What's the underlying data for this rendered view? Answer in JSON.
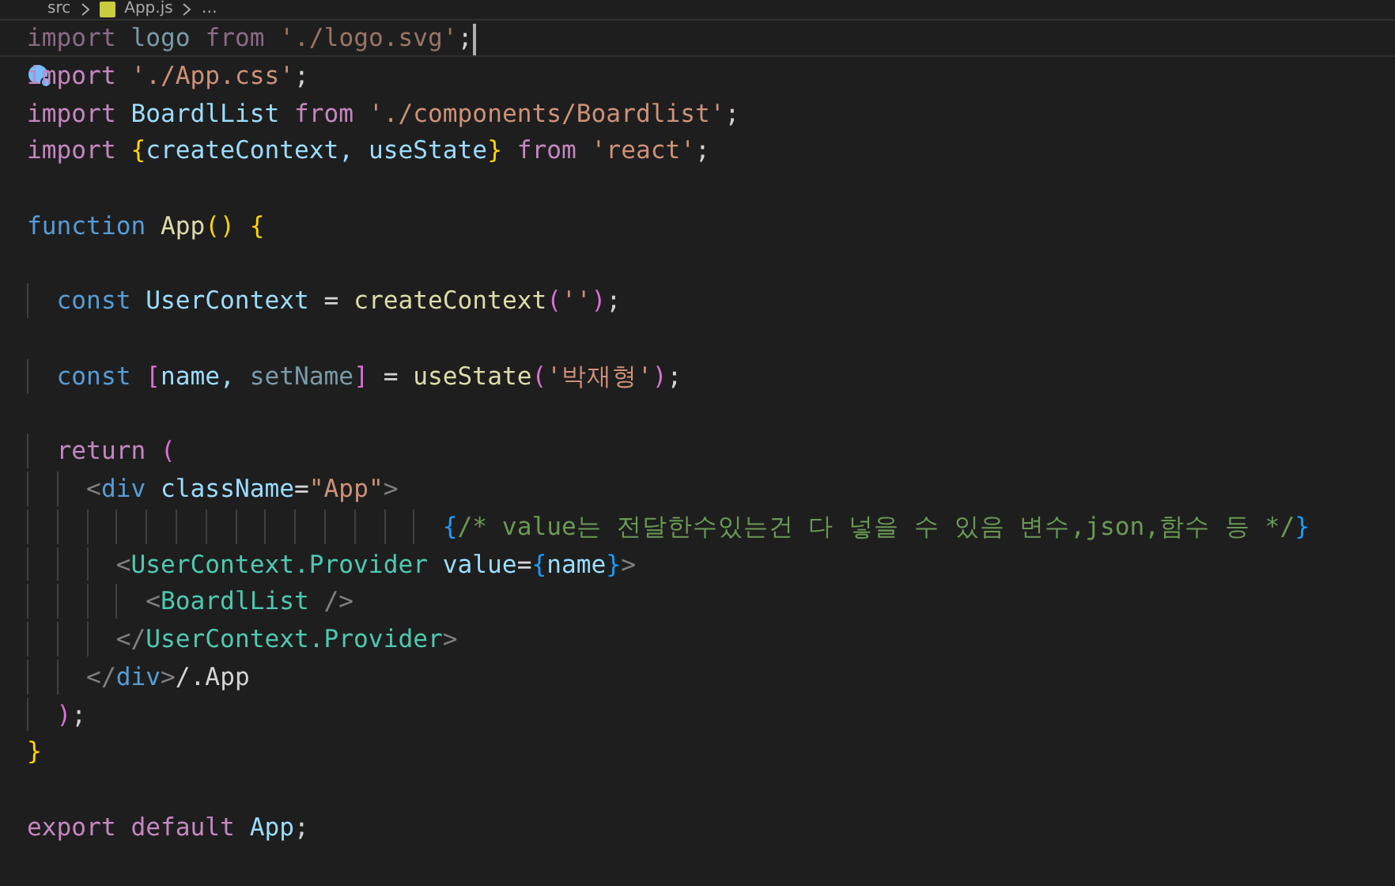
{
  "breadcrumb": [
    {
      "kind": "folder",
      "text": "src"
    },
    {
      "kind": "js_file",
      "text": "App.js"
    },
    {
      "kind": "more",
      "text": "…"
    }
  ],
  "blocks": [
    {
      "lines": [
        {
          "selected": true,
          "tokens": [
            {
              "kind": "dim_keyword",
              "text": "import"
            },
            {
              "kind": "dim_var",
              "text": " logo "
            },
            {
              "kind": "dim_keyword",
              "text": "from"
            },
            {
              "kind": "dim_string",
              "text": " './logo.svg'"
            },
            {
              "kind": "plain",
              "text": ";"
            }
          ]
        },
        {
          "selected": false,
          "tokens": [
            {
              "kind": "keyword",
              "text": "import"
            },
            {
              "kind": "string",
              "text": " './App.css'"
            },
            {
              "kind": "plain",
              "text": ";"
            }
          ]
        },
        {
          "selected": false,
          "tokens": [
            {
              "kind": "keyword",
              "text": "import"
            },
            {
              "kind": "var",
              "text": " BoardlList "
            },
            {
              "kind": "keyword",
              "text": "from"
            },
            {
              "kind": "string",
              "text": " './components/Boardlist'"
            },
            {
              "kind": "plain",
              "text": ";"
            }
          ]
        },
        {
          "selected": false,
          "tokens": [
            {
              "kind": "keyword",
              "text": "import"
            },
            {
              "kind": "bracket_gold",
              "text": " {"
            },
            {
              "kind": "var",
              "text": "createContext, useState"
            },
            {
              "kind": "bracket_gold",
              "text": "}"
            },
            {
              "kind": "keyword",
              "text": " from"
            },
            {
              "kind": "string",
              "text": " 'react'"
            },
            {
              "kind": "plain",
              "text": ";"
            }
          ]
        }
      ]
    },
    {
      "lines": [
        {
          "selected": false,
          "tokens": [
            {
              "kind": "storage",
              "text": "function"
            },
            {
              "kind": "func",
              "text": " App"
            },
            {
              "kind": "bracket_gold",
              "text": "() {"
            }
          ]
        }
      ]
    },
    {
      "lines": [
        {
          "selected": false,
          "tokens": [
            {
              "kind": "storage",
              "text": "  const"
            },
            {
              "kind": "var",
              "text": " UserContext "
            },
            {
              "kind": "plain",
              "text": "= "
            },
            {
              "kind": "func",
              "text": "createContext"
            },
            {
              "kind": "bracket_pink",
              "text": "("
            },
            {
              "kind": "string",
              "text": "''"
            },
            {
              "kind": "bracket_pink",
              "text": ")"
            },
            {
              "kind": "plain",
              "text": ";"
            }
          ]
        }
      ]
    },
    {
      "lines": [
        {
          "selected": false,
          "tokens": [
            {
              "kind": "storage",
              "text": "  const"
            },
            {
              "kind": "bracket_pink",
              "text": " ["
            },
            {
              "kind": "var",
              "text": "name, "
            },
            {
              "kind": "dim_var",
              "text": "setName"
            },
            {
              "kind": "bracket_pink",
              "text": "]"
            },
            {
              "kind": "plain",
              "text": " = "
            },
            {
              "kind": "func",
              "text": "useState"
            },
            {
              "kind": "bracket_pink",
              "text": "("
            },
            {
              "kind": "string",
              "text": "'박재형'"
            },
            {
              "kind": "bracket_pink",
              "text": ")"
            },
            {
              "kind": "plain",
              "text": ";"
            }
          ]
        }
      ]
    },
    {
      "lines": [
        {
          "selected": false,
          "tokens": [
            {
              "kind": "keyword",
              "text": "  return"
            },
            {
              "kind": "bracket_pink",
              "text": " ("
            }
          ]
        },
        {
          "selected": false,
          "tokens": [
            {
              "kind": "tag_punct",
              "text": "    <"
            },
            {
              "kind": "tag",
              "text": "div"
            },
            {
              "kind": "attr",
              "text": " className"
            },
            {
              "kind": "plain",
              "text": "="
            },
            {
              "kind": "string",
              "text": "\"App\""
            },
            {
              "kind": "tag_punct",
              "text": ">"
            }
          ]
        },
        {
          "selected": false,
          "tokens": [
            {
              "kind": "bracket_blue",
              "text": "                            {"
            },
            {
              "kind": "comment",
              "text": "/* value는 전달한수있는건 다 넣을 수 있음 변수,json,함수 등 */"
            },
            {
              "kind": "bracket_blue",
              "text": "}"
            }
          ]
        },
        {
          "selected": false,
          "tokens": [
            {
              "kind": "tag_punct",
              "text": "      <"
            },
            {
              "kind": "component",
              "text": "UserContext.Provider"
            },
            {
              "kind": "attr",
              "text": " value"
            },
            {
              "kind": "plain",
              "text": "="
            },
            {
              "kind": "bracket_blue",
              "text": "{"
            },
            {
              "kind": "var",
              "text": "name"
            },
            {
              "kind": "bracket_blue",
              "text": "}"
            },
            {
              "kind": "tag_punct",
              "text": ">"
            }
          ]
        },
        {
          "selected": false,
          "tokens": [
            {
              "kind": "tag_punct",
              "text": "        <"
            },
            {
              "kind": "component",
              "text": "BoardlList"
            },
            {
              "kind": "tag_punct",
              "text": " />"
            }
          ]
        },
        {
          "selected": false,
          "tokens": [
            {
              "kind": "tag_punct",
              "text": "      </"
            },
            {
              "kind": "component",
              "text": "UserContext.Provider"
            },
            {
              "kind": "tag_punct",
              "text": ">"
            }
          ]
        },
        {
          "selected": false,
          "tokens": [
            {
              "kind": "tag_punct",
              "text": "    </"
            },
            {
              "kind": "tag",
              "text": "div"
            },
            {
              "kind": "tag_punct",
              "text": ">"
            },
            {
              "kind": "plain",
              "text": "/.App"
            }
          ]
        },
        {
          "selected": false,
          "tokens": [
            {
              "kind": "bracket_pink",
              "text": "  )"
            },
            {
              "kind": "plain",
              "text": ";"
            }
          ]
        },
        {
          "selected": false,
          "tokens": [
            {
              "kind": "bracket_gold",
              "text": "}"
            }
          ]
        }
      ]
    },
    {
      "lines": [
        {
          "selected": false,
          "tokens": [
            {
              "kind": "keyword",
              "text": "export default"
            },
            {
              "kind": "var",
              "text": " App"
            },
            {
              "kind": "plain",
              "text": ";"
            }
          ]
        }
      ]
    }
  ]
}
